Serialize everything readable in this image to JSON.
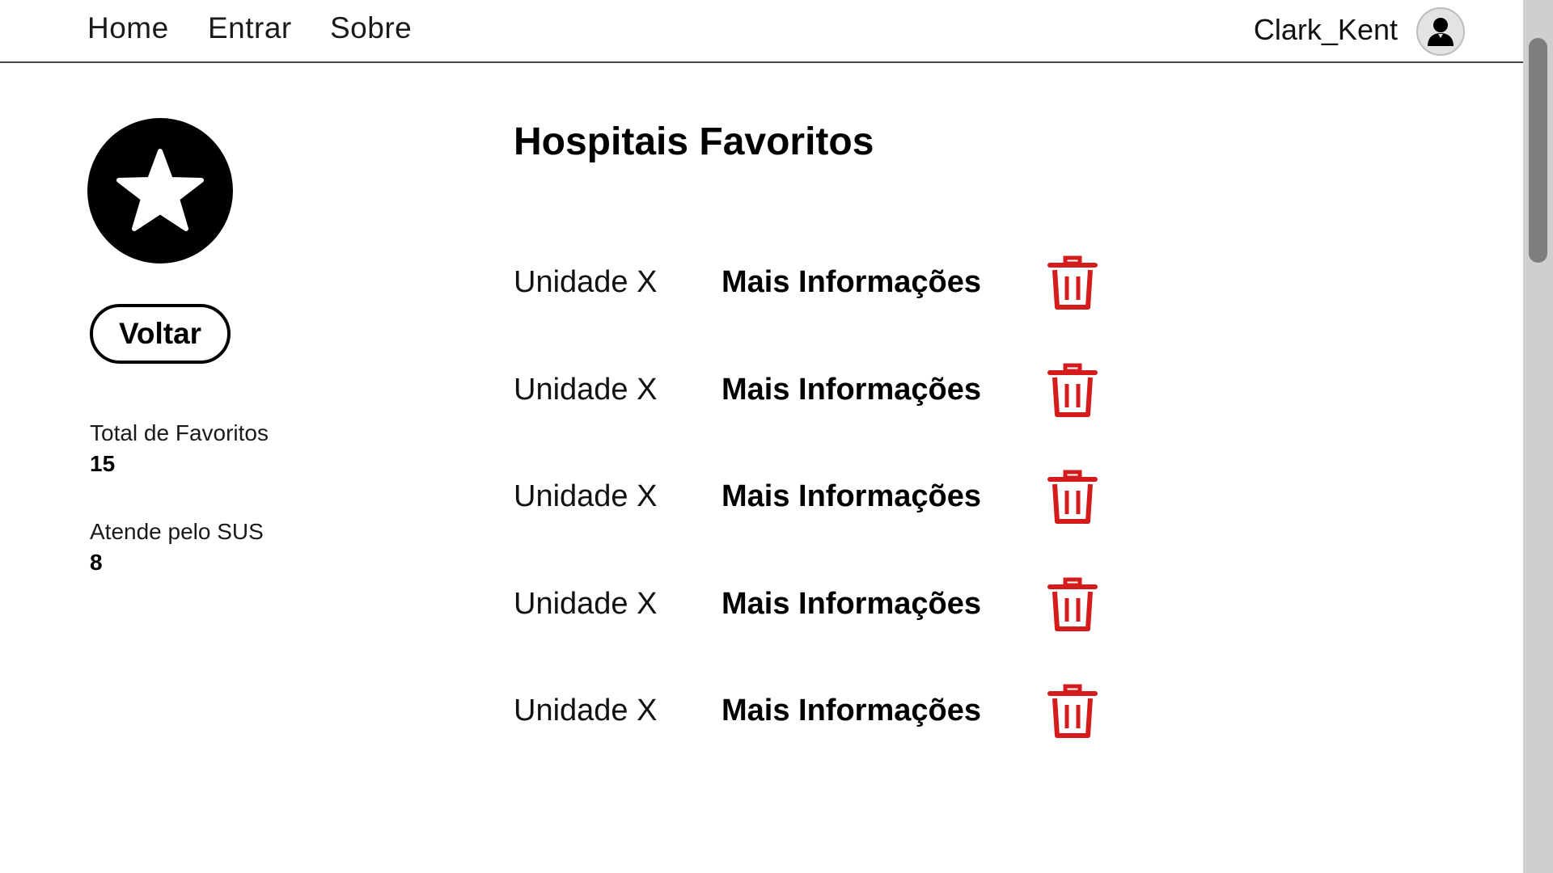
{
  "nav": {
    "links": [
      {
        "label": "Home"
      },
      {
        "label": "Entrar"
      },
      {
        "label": "Sobre"
      }
    ],
    "username": "Clark_Kent",
    "avatar_icon": "user-icon"
  },
  "sidebar": {
    "badge_icon": "star-icon",
    "back_label": "Voltar",
    "stats": [
      {
        "label": "Total de Favoritos",
        "value": "15"
      },
      {
        "label": "Atende pelo SUS",
        "value": "8"
      }
    ]
  },
  "main": {
    "title": "Hospitais Favoritos",
    "favorites": [
      {
        "name": "Unidade X",
        "action": "Mais Informações",
        "delete_icon": "trash-icon"
      },
      {
        "name": "Unidade X",
        "action": "Mais Informações",
        "delete_icon": "trash-icon"
      },
      {
        "name": "Unidade X",
        "action": "Mais Informações",
        "delete_icon": "trash-icon"
      },
      {
        "name": "Unidade X",
        "action": "Mais Informações",
        "delete_icon": "trash-icon"
      },
      {
        "name": "Unidade X",
        "action": "Mais Informações",
        "delete_icon": "trash-icon"
      }
    ]
  },
  "colors": {
    "delete": "#d41c1c",
    "accent": "#000000",
    "scroll_track": "#cfcfcf",
    "scroll_thumb": "#7e7e7e"
  }
}
